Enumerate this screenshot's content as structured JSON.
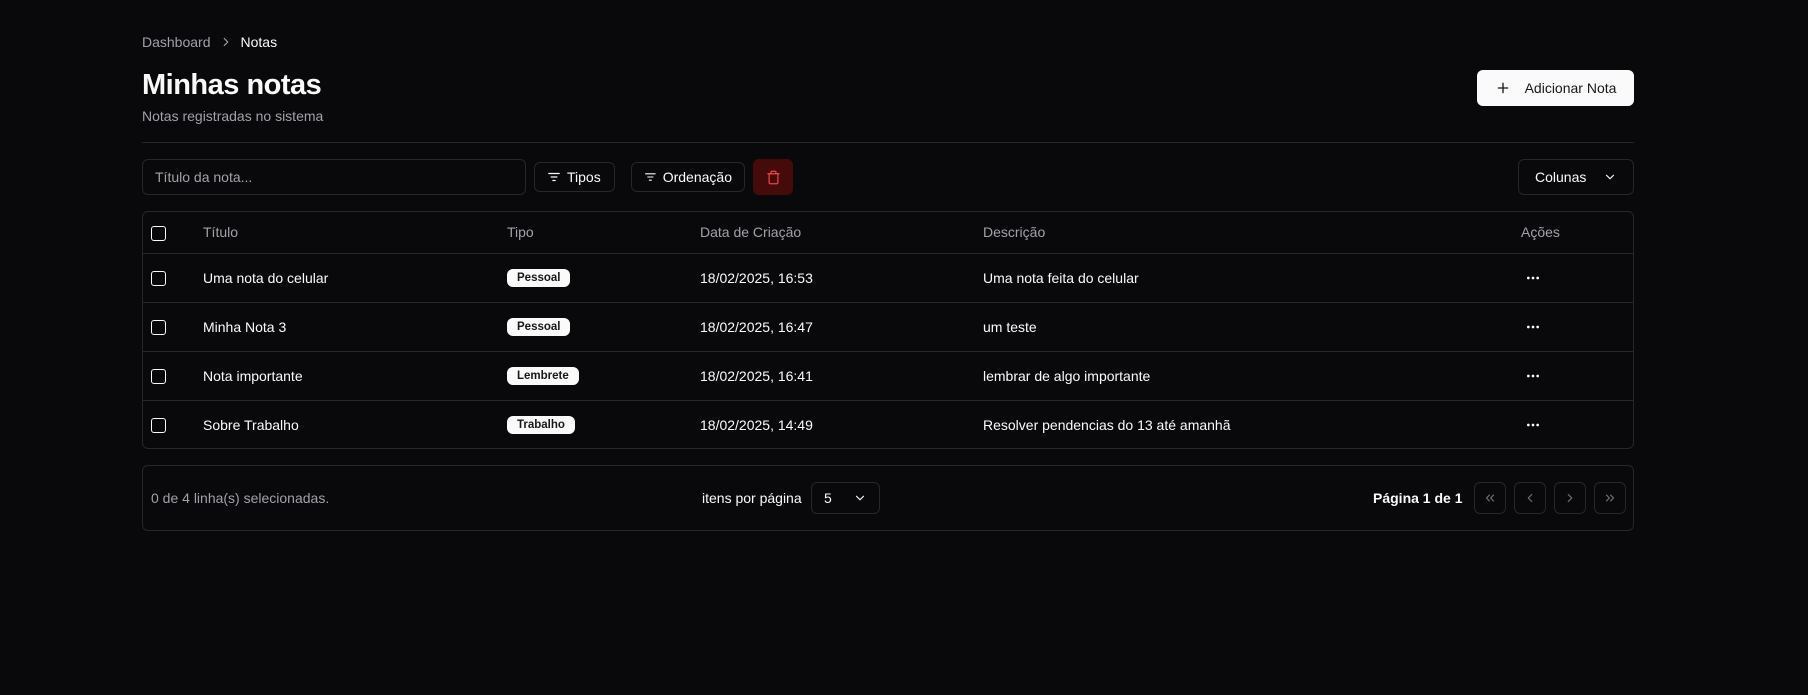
{
  "breadcrumb": {
    "parent": "Dashboard",
    "current": "Notas"
  },
  "header": {
    "title": "Minhas notas",
    "subtitle": "Notas registradas no sistema",
    "add_button_label": "Adicionar Nota"
  },
  "toolbar": {
    "search_placeholder": "Título da nota...",
    "filter_types_label": "Tipos",
    "filter_sort_label": "Ordenação",
    "columns_label": "Colunas"
  },
  "table": {
    "columns": [
      "Título",
      "Tipo",
      "Data de Criação",
      "Descrição",
      "Ações"
    ],
    "rows": [
      {
        "title": "Uma nota do celular",
        "type": "Pessoal",
        "created": "18/02/2025, 16:53",
        "description": "Uma nota feita do celular"
      },
      {
        "title": "Minha Nota 3",
        "type": "Pessoal",
        "created": "18/02/2025, 16:47",
        "description": "um teste"
      },
      {
        "title": "Nota importante",
        "type": "Lembrete",
        "created": "18/02/2025, 16:41",
        "description": "lembrar de algo importante"
      },
      {
        "title": "Sobre Trabalho",
        "type": "Trabalho",
        "created": "18/02/2025, 14:49",
        "description": "Resolver pendencias do 13 até amanhã"
      }
    ]
  },
  "footer": {
    "selection_text": "0 de 4 linha(s) selecionadas.",
    "per_page_label": "itens por página",
    "per_page_value": "5",
    "page_info": "Página 1 de 1"
  },
  "colors": {
    "background": "#09090b",
    "border": "#27272a",
    "muted_text": "#a1a1aa",
    "foreground": "#fafafa",
    "destructive": "#450a0a",
    "destructive_icon": "#ef4444"
  },
  "icons": {
    "breadcrumb_separator": "chevron-right-icon",
    "add": "plus-icon",
    "filter": "filter-icon",
    "delete": "trash-icon",
    "dropdown": "chevron-down-icon",
    "row_actions": "ellipsis-icon",
    "pager": [
      "chevrons-left-icon",
      "chevron-left-icon",
      "chevron-right-icon",
      "chevrons-right-icon"
    ]
  }
}
